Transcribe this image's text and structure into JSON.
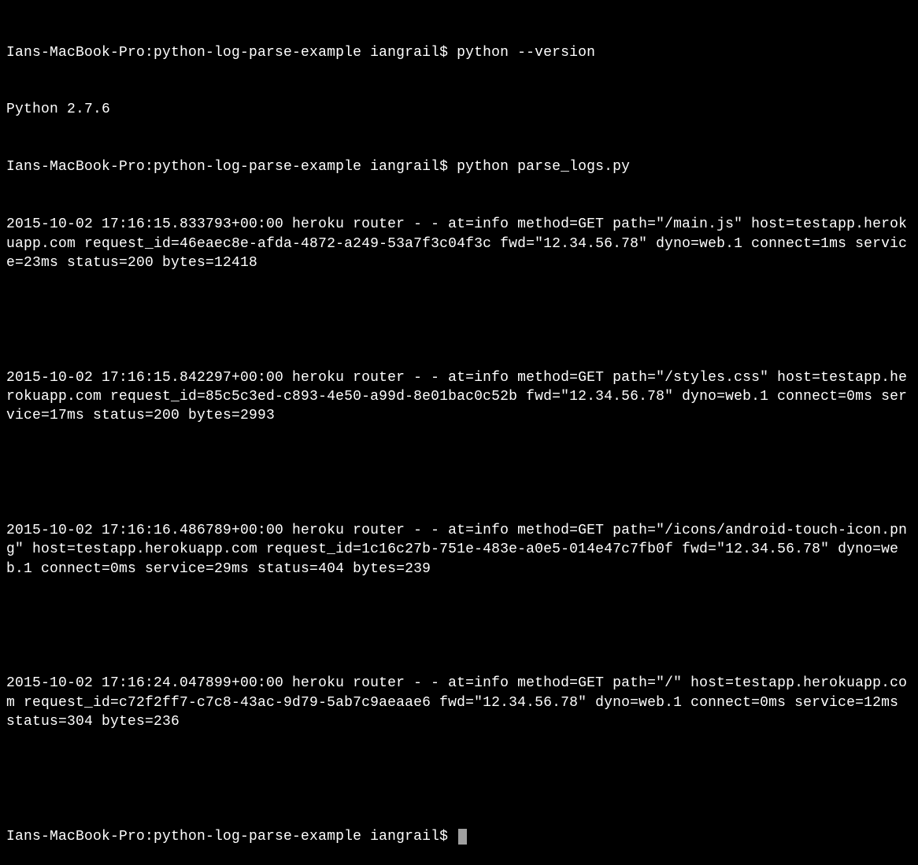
{
  "terminal": {
    "prompt": "Ians-MacBook-Pro:python-log-parse-example iangrail$ ",
    "commands": {
      "version": "python --version",
      "run": "python parse_logs.py"
    },
    "output": {
      "version": "Python 2.7.6",
      "log1": "2015-10-02 17:16:15.833793+00:00 heroku router - - at=info method=GET path=\"/main.js\" host=testapp.herokuapp.com request_id=46eaec8e-afda-4872-a249-53a7f3c04f3c fwd=\"12.34.56.78\" dyno=web.1 connect=1ms service=23ms status=200 bytes=12418",
      "log2": "2015-10-02 17:16:15.842297+00:00 heroku router - - at=info method=GET path=\"/styles.css\" host=testapp.herokuapp.com request_id=85c5c3ed-c893-4e50-a99d-8e01bac0c52b fwd=\"12.34.56.78\" dyno=web.1 connect=0ms service=17ms status=200 bytes=2993",
      "log3": "2015-10-02 17:16:16.486789+00:00 heroku router - - at=info method=GET path=\"/icons/android-touch-icon.png\" host=testapp.herokuapp.com request_id=1c16c27b-751e-483e-a0e5-014e47c7fb0f fwd=\"12.34.56.78\" dyno=web.1 connect=0ms service=29ms status=404 bytes=239",
      "log4": "2015-10-02 17:16:24.047899+00:00 heroku router - - at=info method=GET path=\"/\" host=testapp.herokuapp.com request_id=c72f2ff7-c7c8-43ac-9d79-5ab7c9aeaae6 fwd=\"12.34.56.78\" dyno=web.1 connect=0ms service=12ms status=304 bytes=236"
    }
  }
}
